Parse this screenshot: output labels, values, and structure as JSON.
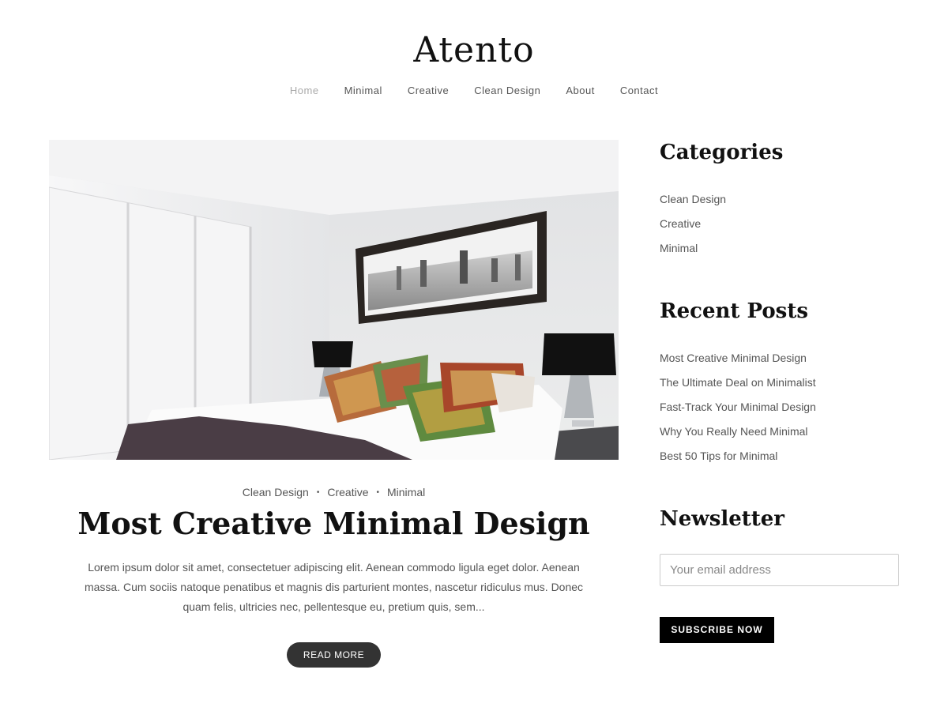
{
  "site": {
    "title": "Atento"
  },
  "nav": {
    "items": [
      {
        "label": "Home"
      },
      {
        "label": "Minimal"
      },
      {
        "label": "Creative"
      },
      {
        "label": "Clean Design"
      },
      {
        "label": "About"
      },
      {
        "label": "Contact"
      }
    ],
    "active": "Home"
  },
  "post": {
    "categories": [
      "Clean Design",
      "Creative",
      "Minimal"
    ],
    "title": "Most Creative Minimal Design",
    "excerpt": "Lorem ipsum dolor sit amet, consectetuer adipiscing elit. Aenean commodo ligula eget dolor. Aenean massa. Cum sociis natoque penatibus et magnis dis parturient montes, nascetur ridiculus mus. Donec quam felis, ultricies nec, pellentesque eu, pretium quis, sem...",
    "read_more": "READ MORE"
  },
  "sidebar": {
    "categories": {
      "title": "Categories",
      "items": [
        "Clean Design",
        "Creative",
        "Minimal"
      ]
    },
    "recent_posts": {
      "title": "Recent Posts",
      "items": [
        "Most Creative Minimal Design",
        "The Ultimate Deal on Minimalist",
        "Fast-Track Your Minimal Design",
        "Why You Really Need Minimal",
        "Best 50 Tips for Minimal"
      ]
    },
    "newsletter": {
      "title": "Newsletter",
      "email_placeholder": "Your email address",
      "email_value": "",
      "subscribe_label": "SUBSCRIBE NOW"
    }
  },
  "colors": {
    "text_dark": "#111111",
    "text_body": "#555555",
    "nav_active": "#aaaaaa",
    "button_dark": "#333333",
    "subscribe_bg": "#000000"
  }
}
